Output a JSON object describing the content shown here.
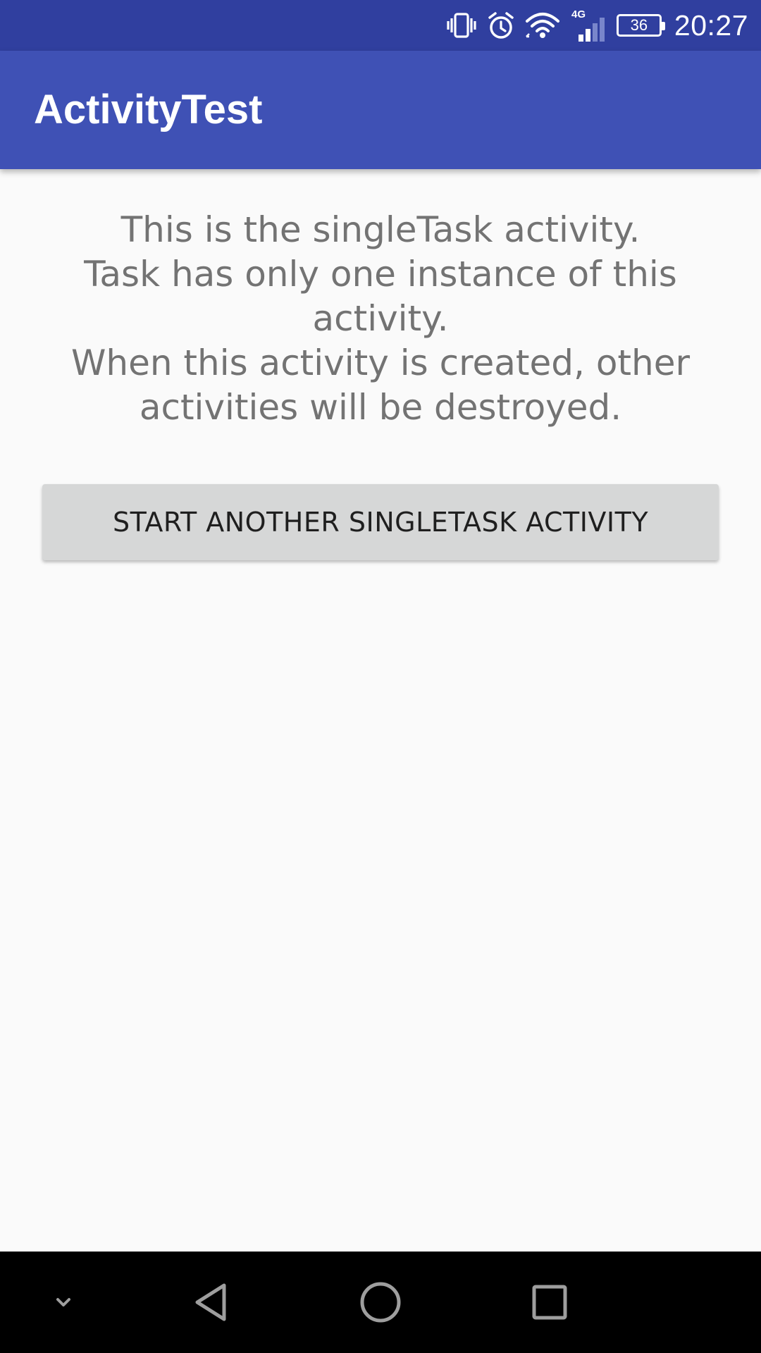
{
  "status_bar": {
    "time": "20:27",
    "battery_level": "36",
    "network_type": "4G",
    "icons": [
      "vibrate-icon",
      "alarm-icon",
      "wifi-icon",
      "cell-signal-icon",
      "battery-icon"
    ],
    "background_color": "#303f9f"
  },
  "app_bar": {
    "title": "ActivityTest",
    "background_color": "#3f51b5"
  },
  "main": {
    "description_lines": [
      "This is the singleTask activity.",
      "Task has only one instance of this activity.",
      "When this activity is created, other activities will be destroyed."
    ],
    "button_label": "START ANOTHER SINGLETASK ACTIVITY"
  },
  "nav_bar": {
    "items": [
      "chevron-down-icon",
      "back-icon",
      "home-icon",
      "recents-icon"
    ]
  }
}
